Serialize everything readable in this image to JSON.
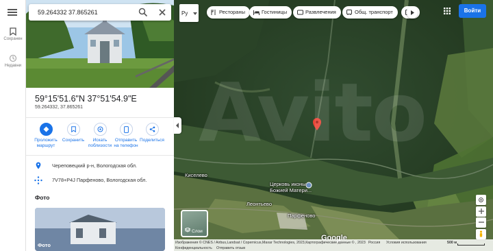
{
  "rail": {
    "saved_label": "Сохранен",
    "recent_label": "Недавни"
  },
  "search": {
    "query": "59.264332 37.865261"
  },
  "place": {
    "dms": "59°15'51.6\"N 37°51'54.9\"E",
    "decimal": "59.264332, 37.865261"
  },
  "actions": [
    {
      "label": "Проложить маршрут",
      "icon": "directions-icon"
    },
    {
      "label": "Сохранить",
      "icon": "bookmark-icon"
    },
    {
      "label": "Искать поблизости",
      "icon": "nearby-icon"
    },
    {
      "label": "Отправить на телефон",
      "icon": "phone-icon"
    },
    {
      "label": "Поделиться",
      "icon": "share-icon"
    }
  ],
  "info": {
    "region": "Череповецкий р-н, Вологодская обл.",
    "pluscode": "7V78+P4J Парфеново, Вологодская обл."
  },
  "photos": {
    "title": "Фото",
    "caption": "Фото"
  },
  "map": {
    "lang": "Ру",
    "chips": [
      "Рестораны",
      "Гостиницы",
      "Развлечения",
      "Общ. транспорт",
      "Р"
    ],
    "signin": "Войти",
    "labels": {
      "kiselevo": "Киселево",
      "church_line1": "Церковь иконы",
      "church_line2": "Божией Матери...",
      "leontievo": "Леонтьево",
      "parfenovo": "Парфеново"
    },
    "layers_label": "Слои",
    "watermark": "Avito",
    "google": "Google"
  },
  "footer": {
    "imagery": "Изображения © CNES / Airbus,Landsat / Copernicus,Maxar Technologies, 2023,Картографические данные © , 2023",
    "country": "Россия",
    "terms": "Условия использования",
    "privacy": "Конфиденциальность",
    "feedback": "Отправить отзыв",
    "scale": "500 м"
  },
  "colors": {
    "accent": "#1a73e8",
    "pin": "#ea4335"
  }
}
